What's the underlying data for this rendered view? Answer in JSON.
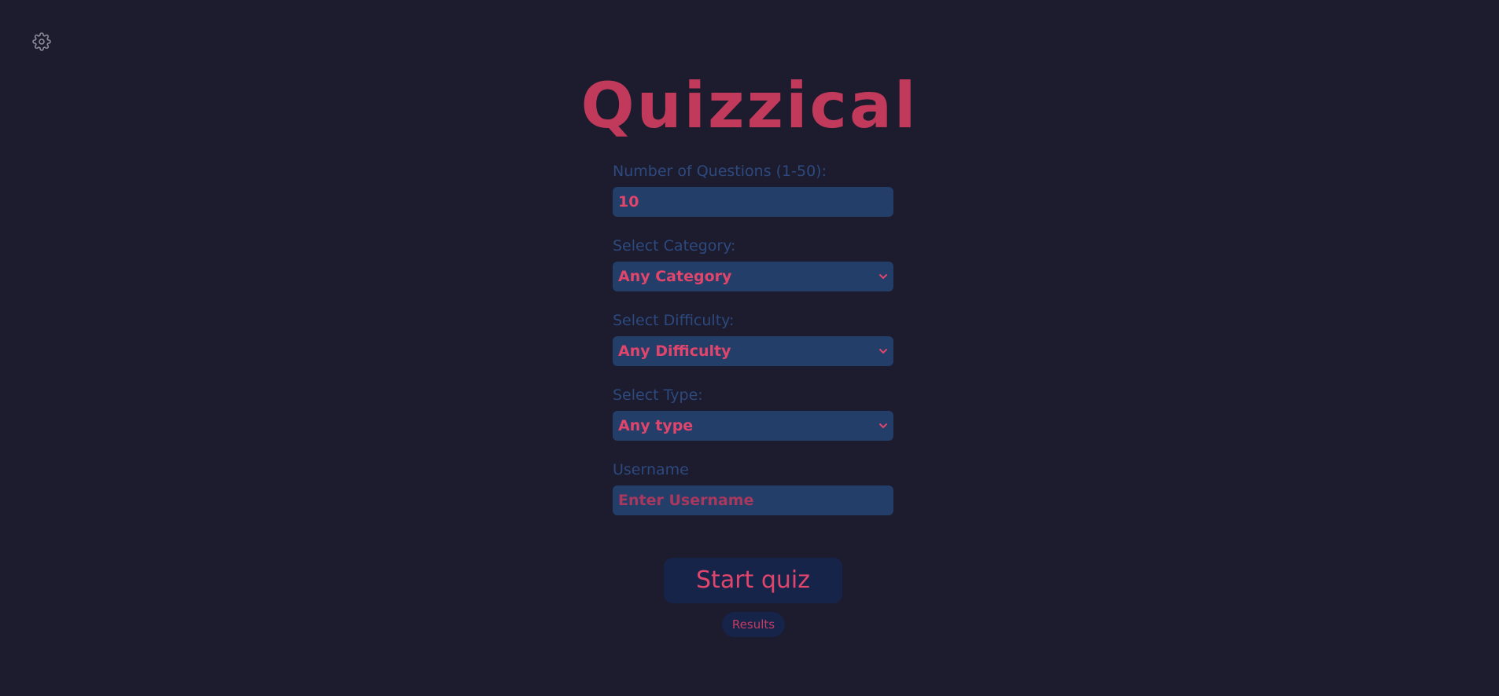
{
  "app": {
    "title": "Quizzical"
  },
  "header": {
    "settings_icon": "gear-icon"
  },
  "form": {
    "questions": {
      "label": "Number of Questions (1-50):",
      "value": "10"
    },
    "category": {
      "label": "Select Category:",
      "selected": "Any Category"
    },
    "difficulty": {
      "label": "Select Difficulty:",
      "selected": "Any Difficulty"
    },
    "type": {
      "label": "Select Type:",
      "selected": "Any type"
    },
    "username": {
      "label": "Username",
      "placeholder": "Enter Username",
      "value": ""
    }
  },
  "actions": {
    "start_label": "Start quiz",
    "results_label": "Results"
  },
  "colors": {
    "background": "#1d1b2e",
    "accent": "#c23a5b",
    "field_bg": "#233e69",
    "label": "#2d4a7f",
    "button_bg": "#16244a"
  }
}
